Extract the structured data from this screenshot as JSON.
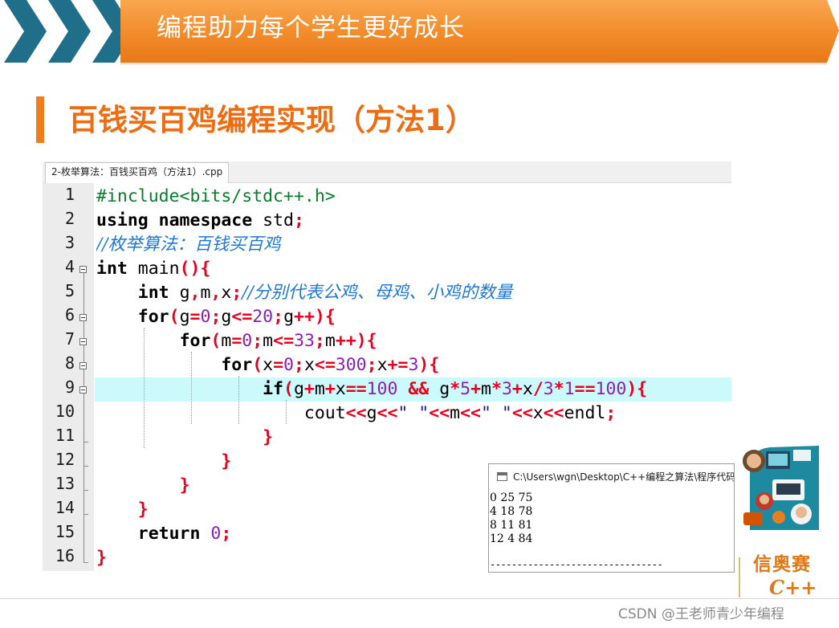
{
  "header": {
    "banner_title": "编程助力每个学生更好成长"
  },
  "section": {
    "title": "百钱买百鸡编程实现（方法1）"
  },
  "editor": {
    "tab_label": "2-枚举算法：百钱买百鸡（方法1）.cpp",
    "line_numbers": [
      "1",
      "2",
      "3",
      "4",
      "5",
      "6",
      "7",
      "8",
      "9",
      "10",
      "11",
      "12",
      "13",
      "14",
      "15",
      "16"
    ],
    "highlighted_line": 9
  },
  "console": {
    "title": "C:\\Users\\wgn\\Desktop\\C++编程之算法\\程序代码",
    "output_lines": [
      "0 25 75",
      "4 18 78",
      "8 11 81",
      "12 4 84"
    ],
    "separator": "--------------------------------"
  },
  "branding": {
    "logo_line1": "信奥赛",
    "logo_line2": "C++",
    "watermark": "CSDN @王老师青少年编程"
  },
  "colors": {
    "banner_orange": "#f28b2a",
    "chevron_teal": "#1f6f8b",
    "title_orange": "#ee6d12",
    "highlight_cyan": "#ccf9fc"
  }
}
